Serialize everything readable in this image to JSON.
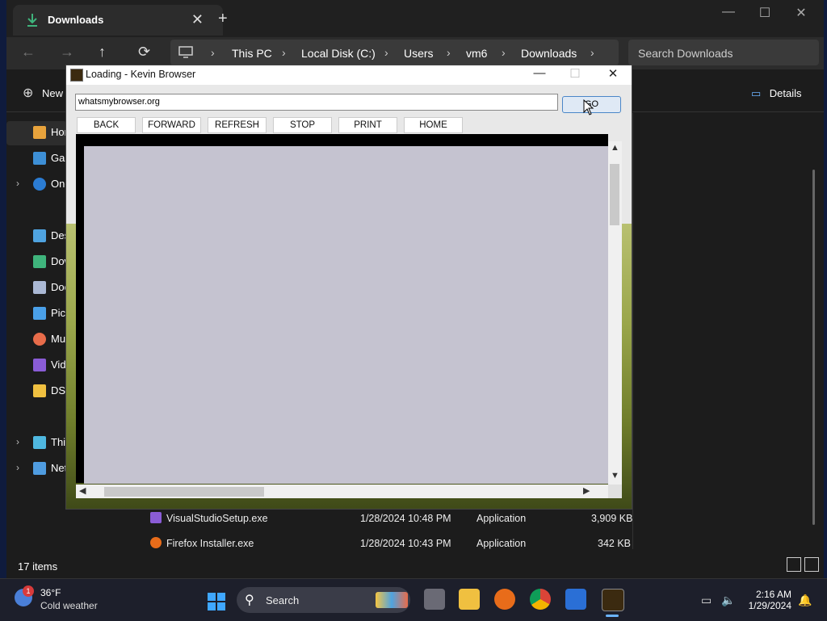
{
  "explorer": {
    "tab_title": "Downloads",
    "new_tab": "+",
    "window_controls": [
      "—",
      "☐",
      "✕"
    ],
    "nav": {
      "back": "←",
      "forward": "→",
      "up": "↑",
      "refresh": "⟳"
    },
    "breadcrumb": [
      "This PC",
      "Local Disk (C:)",
      "Users",
      "vm6",
      "Downloads"
    ],
    "search_placeholder": "Search Downloads",
    "cmd_new": "New",
    "details_label": "Details",
    "sidebar": [
      {
        "label": "Home",
        "icon": "home-icon",
        "color": "#e8a33c"
      },
      {
        "label": "Gallery",
        "icon": "gallery-icon",
        "color": "#3d8fd6"
      },
      {
        "label": "OneDrive",
        "icon": "cloud-icon",
        "color": "#2b7cd3"
      },
      {
        "label": "Desktop",
        "icon": "desktop-icon",
        "color": "#4fa3e0"
      },
      {
        "label": "Downloads",
        "icon": "download-icon",
        "color": "#3fb47c"
      },
      {
        "label": "Documents",
        "icon": "document-icon",
        "color": "#aab8d4"
      },
      {
        "label": "Pictures",
        "icon": "pictures-icon",
        "color": "#4aa0e8"
      },
      {
        "label": "Music",
        "icon": "music-icon",
        "color": "#e86c4a"
      },
      {
        "label": "Videos",
        "icon": "video-icon",
        "color": "#8a5cd6"
      },
      {
        "label": "DS",
        "icon": "folder-icon",
        "color": "#f0c040"
      },
      {
        "label": "This PC",
        "icon": "pc-icon",
        "color": "#4fb8e0"
      },
      {
        "label": "Network",
        "icon": "network-icon",
        "color": "#4f9ce0"
      }
    ],
    "files": [
      {
        "name": "VisualStudioSetup.exe",
        "date": "1/28/2024 10:48 PM",
        "type": "Application",
        "size": "3,909 KB",
        "icon": "visualstudio-icon"
      },
      {
        "name": "Firefox Installer.exe",
        "date": "1/28/2024 10:43 PM",
        "type": "Application",
        "size": "342 KB",
        "icon": "firefox-icon"
      }
    ],
    "item_count": "17 items"
  },
  "browser": {
    "title": "Loading - Kevin Browser",
    "url": "whatsmybrowser.org",
    "go_label": "GO",
    "buttons": {
      "back": "BACK",
      "forward": "FORWARD",
      "refresh": "REFRESH",
      "stop": "STOP",
      "print": "PRINT",
      "home": "HOME"
    }
  },
  "taskbar": {
    "weather_temp": "36°F",
    "weather_desc": "Cold weather",
    "weather_badge": "1",
    "search_label": "Search",
    "time": "2:16 AM",
    "date": "1/29/2024"
  }
}
